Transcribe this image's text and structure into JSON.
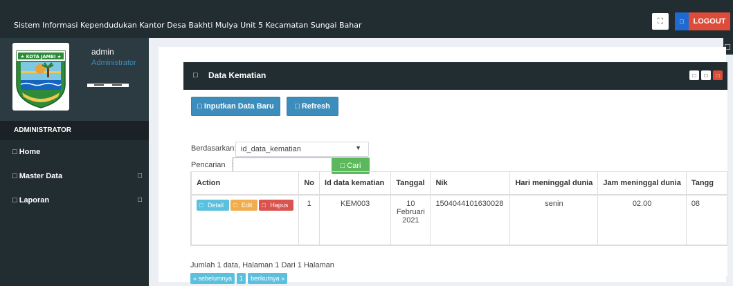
{
  "header": {
    "title": "Sistem Informasi Kependudukan Kantor Desa Bakhti Mulya Unit 5 Kecamatan Sungai Bahar",
    "expand_icon": "expand-icon",
    "logout_icon": "logout-icon",
    "logout_label": "LOGOUT"
  },
  "sidebar": {
    "logo_text": "★ KOTA JAMBI ★",
    "user_name": "admin",
    "user_role": "Administrator",
    "section_header": "ADMINISTRATOR",
    "items": [
      {
        "icon": "home-icon",
        "label": "Home"
      },
      {
        "icon": "master-data-icon",
        "label": "Master Data",
        "arrow": "chevron-icon"
      },
      {
        "icon": "report-icon",
        "label": "Laporan",
        "arrow": "chevron-icon"
      }
    ]
  },
  "box": {
    "title": "Data Kematian",
    "add_button": "Inputkan Data Baru",
    "refresh_button": "Refresh",
    "filter_label": "Berdasarkan:",
    "filter_value": "id_data_kematian",
    "search_label": "Pencarian",
    "search_value": "",
    "search_button": "Cari"
  },
  "table": {
    "columns": [
      "Action",
      "No",
      "Id data kematian",
      "Tanggal",
      "Nik",
      "Hari meninggal dunia",
      "Jam meninggal dunia",
      "Tangg"
    ],
    "rows": [
      {
        "actions": [
          "Detail",
          "Edit",
          "Hapus"
        ],
        "no": "1",
        "id": "KEM003",
        "tanggal_1": "10",
        "tanggal_2": "Februari",
        "tanggal_3": "2021",
        "nik": "1504044101630028",
        "hari": "senin",
        "jam": "02.00",
        "tangg": "08"
      }
    ]
  },
  "footer": {
    "summary": "Jumlah 1 data, Halaman 1 Dari 1 Halaman",
    "prev": "« sebelumnya",
    "page": "1",
    "next": "berikutnya »"
  },
  "colors": {
    "dark": "#222d32",
    "primary": "#3c8dbc",
    "danger": "#dd4b39",
    "success": "#5cb85c",
    "info": "#5bc0de",
    "warning": "#f0ad4e"
  }
}
